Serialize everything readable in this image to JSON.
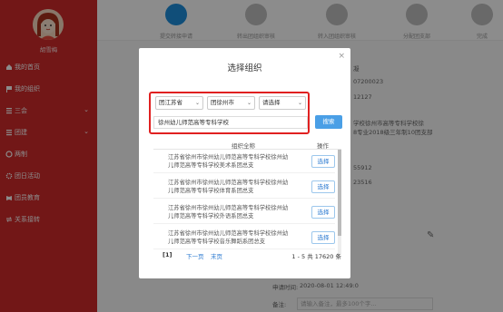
{
  "sidebar": {
    "user_name": "胡雪梅",
    "items": [
      {
        "label": "我的首页"
      },
      {
        "label": "我的组织"
      },
      {
        "label": "三会"
      },
      {
        "label": "团建"
      },
      {
        "label": "两制"
      },
      {
        "label": "团日活动"
      },
      {
        "label": "团员教育"
      },
      {
        "label": "关系接转"
      }
    ]
  },
  "background": {
    "steps": [
      "提交转接申请",
      "转出团组织审核",
      "转入团组织审核",
      "分配团支部",
      "完成"
    ],
    "fields": [
      "凝",
      "07200023",
      "12127",
      "8专业2018级三年制10团支部",
      "学校徐州市高等专科学校徐",
      "55912",
      "23516"
    ],
    "apply_time_label": "申请时间:",
    "apply_time_value": "2020-08-01 12:49:0",
    "remark_label": "备注:",
    "remark_placeholder": "请输入备注，最多100个字..."
  },
  "modal": {
    "title": "选择组织",
    "close": "×",
    "province": "团江苏省",
    "city": "团徐州市",
    "district": "请选择",
    "search_value": "徐州幼儿师范高等专科学校",
    "search_button": "搜索",
    "col_name": "组织全称",
    "col_action": "操作",
    "rows": [
      {
        "name": "江苏省徐州市徐州幼儿师范高等专科学校徐州幼儿师范高等专科学校美术系团总支",
        "action": "选择"
      },
      {
        "name": "江苏省徐州市徐州幼儿师范高等专科学校徐州幼儿师范高等专科学校体育系团总支",
        "action": "选择"
      },
      {
        "name": "江苏省徐州市徐州幼儿师范高等专科学校徐州幼儿师范高等专科学校外语系团总支",
        "action": "选择"
      },
      {
        "name": "江苏省徐州市徐州幼儿师范高等专科学校徐州幼儿师范高等专科学校音乐舞蹈系团总支",
        "action": "选择"
      }
    ],
    "pager": {
      "current": "[1]",
      "next": "下一页",
      "last": "末页",
      "total": "1 - 5 共 17620 条"
    }
  },
  "colors": {
    "sidebar_red": "#cf2a2a",
    "accent_blue": "#4a9fe6",
    "highlight_red": "#e02020"
  }
}
